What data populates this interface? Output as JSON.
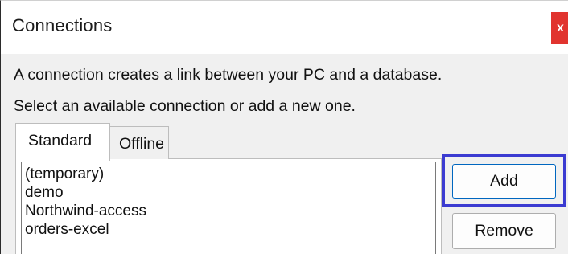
{
  "window": {
    "title": "Connections",
    "close_label": "x"
  },
  "description": {
    "line1": "A connection creates a link between your PC and a database.",
    "line2": "Select an available connection or add a new one."
  },
  "tabs": [
    {
      "label": "Standard",
      "selected": true
    },
    {
      "label": "Offline",
      "selected": false
    }
  ],
  "connections": [
    "(temporary)",
    "demo",
    "Northwind-access",
    "orders-excel"
  ],
  "buttons": {
    "add_label": "Add",
    "remove_label": "Remove"
  },
  "colors": {
    "close_button": "#e1342f",
    "focus_highlight": "#3b3bd1"
  }
}
